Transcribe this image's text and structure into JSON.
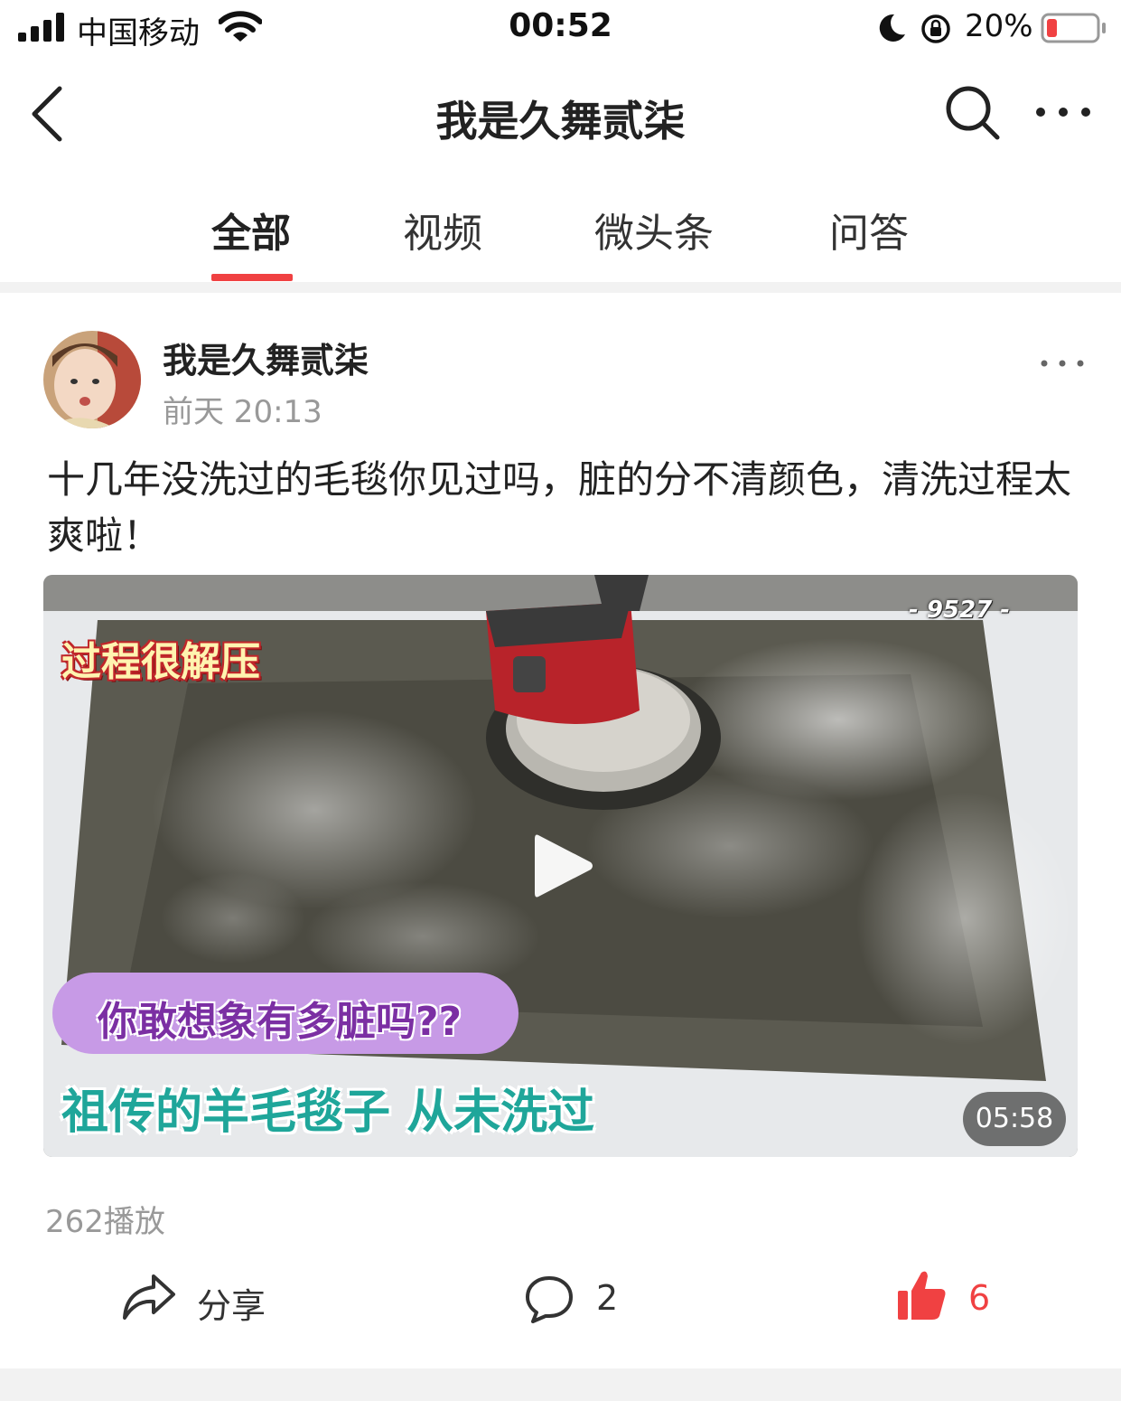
{
  "status_bar": {
    "carrier": "中国移动",
    "time": "00:52",
    "battery_percent": "20%",
    "battery_color": "#f04142"
  },
  "nav": {
    "title": "我是久舞贰柒",
    "back_icon": "chevron-left-icon",
    "search_icon": "search-icon",
    "more_icon": "more-horizontal-icon"
  },
  "tabs": [
    {
      "label": "全部",
      "active": true
    },
    {
      "label": "视频",
      "active": false
    },
    {
      "label": "微头条",
      "active": false
    },
    {
      "label": "问答",
      "active": false
    }
  ],
  "accent_color": "#f04142",
  "post": {
    "author": "我是久舞贰柒",
    "time": "前天 20:13",
    "text": "十几年没洗过的毛毯你见过吗，脏的分不清颜色，清洗过程太爽啦！",
    "video": {
      "watermark": "- 9527 -",
      "caption_top": "过程很解压",
      "caption_pill": "你敢想象有多脏吗??",
      "caption_bottom": "祖传的羊毛毯子 从未洗过",
      "duration": "05:58"
    },
    "plays": "262播放",
    "actions": {
      "share_label": "分享",
      "comment_count": "2",
      "like_count": "6"
    }
  }
}
